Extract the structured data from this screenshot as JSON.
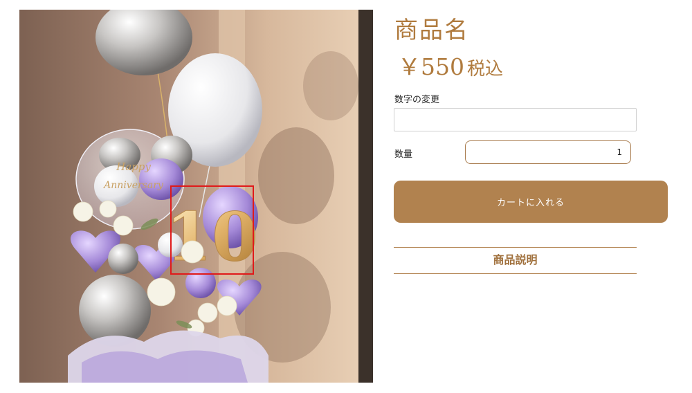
{
  "product": {
    "name": "商品名",
    "price": "￥550",
    "tax_label": "税込",
    "image_alt": "Happy Anniversary バルーン 10"
  },
  "form": {
    "number_label": "数字の変更",
    "number_value": "",
    "quantity_label": "数量",
    "quantity_value": "1",
    "add_to_cart_label": "カートに入れる"
  },
  "description": {
    "heading": "商品説明"
  },
  "image_text": {
    "balloon_text_1": "Happy",
    "balloon_text_2": "Anniversary",
    "number_balloon": "10"
  },
  "colors": {
    "accent": "#b1824f",
    "title": "#b07b3e",
    "highlight": "#e01a1a"
  }
}
